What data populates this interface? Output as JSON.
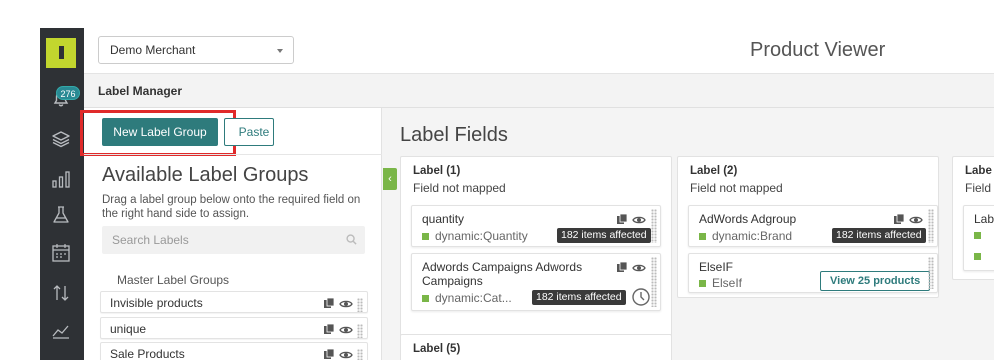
{
  "sidebar": {
    "badge_count": "276",
    "icons": [
      "logo-icon",
      "bell-icon",
      "layers-icon",
      "bar-chart-icon",
      "flask-icon",
      "calendar-icon",
      "sort-arrows-icon",
      "area-chart-icon"
    ]
  },
  "topbar": {
    "merchant_value": "Demo Merchant",
    "page_title": "Product Viewer"
  },
  "label_manager": {
    "title": "Label Manager",
    "new_group_label": "New Label Group",
    "paste_label": "Paste",
    "available_title": "Available Label Groups",
    "description": "Drag a label group below onto the required field on the right hand side to assign.",
    "search_placeholder": "Search Labels",
    "master_heading": "Master Label Groups",
    "groups": [
      {
        "label": "Invisible products"
      },
      {
        "label": "unique"
      },
      {
        "label": "Sale Products"
      }
    ]
  },
  "label_fields": {
    "title": "Label Fields",
    "fields": [
      {
        "title": "Label (1)",
        "subtitle": "Field not mapped",
        "rules": [
          {
            "name": "quantity",
            "source": "dynamic:Quantity",
            "affected": "182 items affected"
          },
          {
            "name": "Adwords Campaigns Adwords Campaigns",
            "source": "dynamic:Cat...",
            "affected": "182 items affected"
          }
        ]
      },
      {
        "title": "Label (2)",
        "subtitle": "Field not mapped",
        "rules": [
          {
            "name": "AdWords Adgroup",
            "source": "dynamic:Brand",
            "affected": "182 items affected"
          },
          {
            "name": "ElseIF",
            "source": "ElseIf",
            "action": "View 25 products"
          }
        ]
      },
      {
        "title": "Labe",
        "subtitle": "Field"
      },
      {
        "title": "Label (5)"
      }
    ]
  },
  "colors": {
    "accent_teal": "#2e7b7c",
    "logo_green": "#c2d62e",
    "highlight_red": "#e02a2a",
    "status_green": "#7ab648",
    "sidebar_dark": "#2e3135"
  }
}
